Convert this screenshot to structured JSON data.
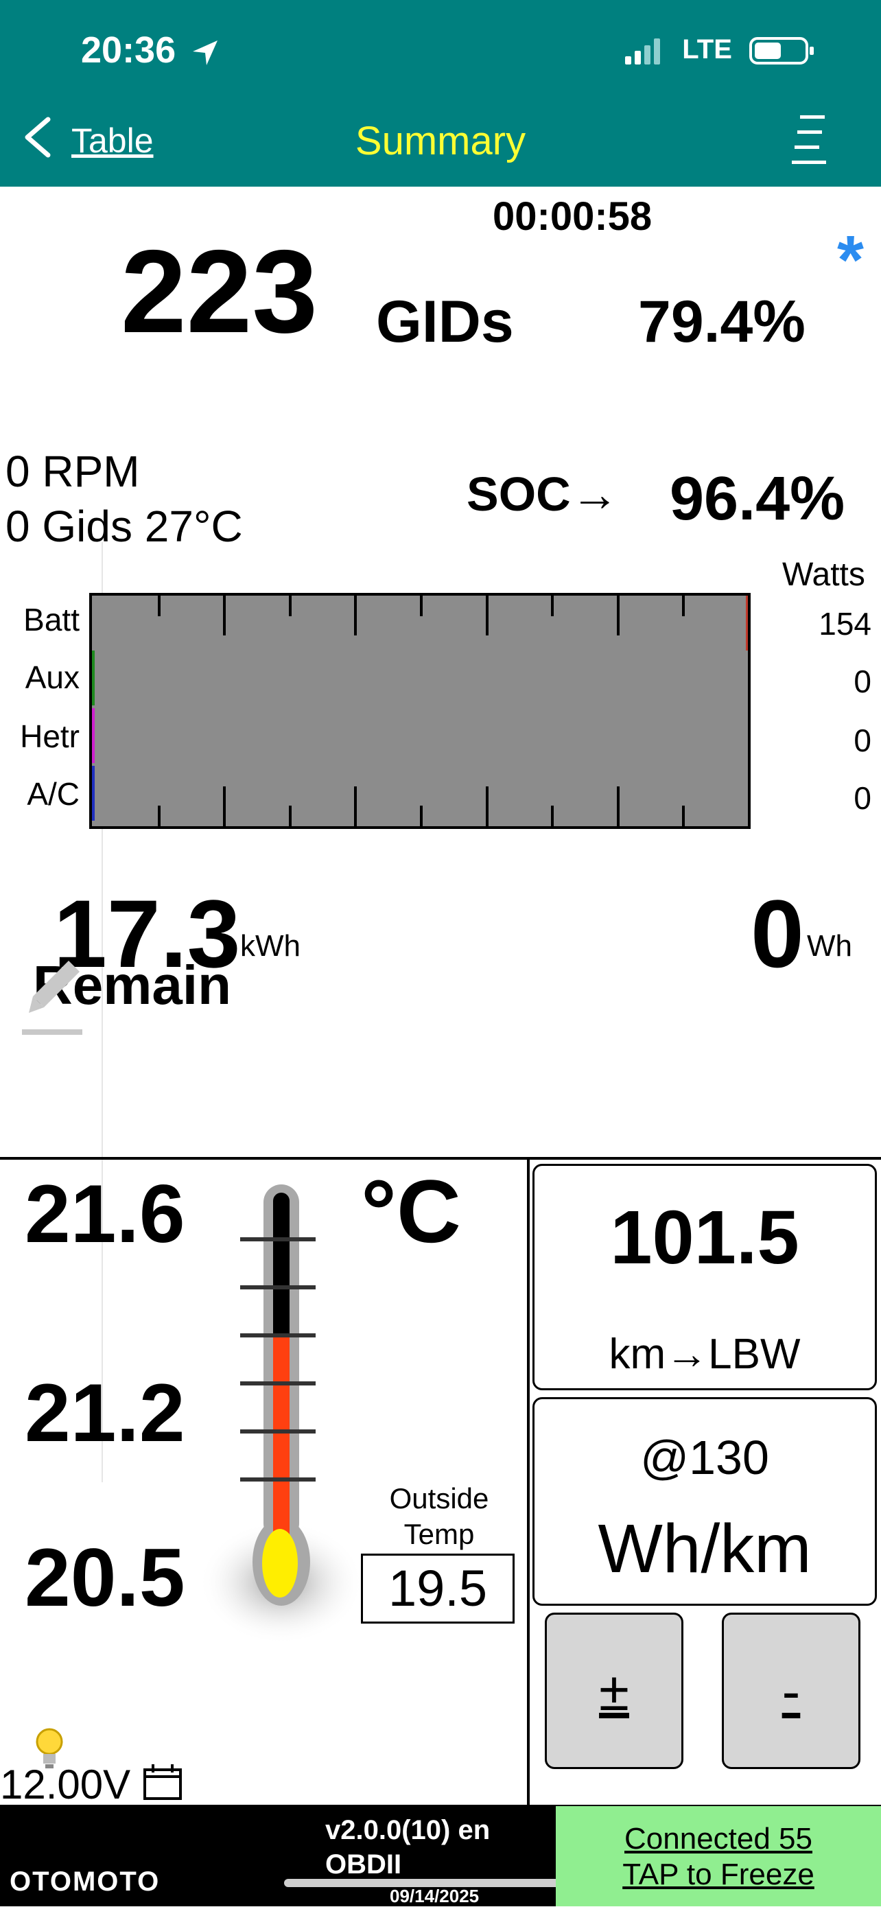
{
  "status": {
    "time": "20:36",
    "network": "LTE"
  },
  "nav": {
    "back_label": "Table",
    "title": "Summary"
  },
  "summary": {
    "timer": "00:00:58",
    "gids": "223",
    "gids_unit": "GIDs",
    "gids_percent": "79.4%",
    "star": "*",
    "rpm": "0 RPM",
    "gids_temp": "0 Gids 27°C",
    "soc_label": "SOC→",
    "soc_value": "96.4%"
  },
  "power": {
    "header": "Watts",
    "rows": [
      {
        "label": "Batt",
        "watts": "154",
        "color": "#c0392b"
      },
      {
        "label": "Aux",
        "watts": "0",
        "color": "#1e8c1e"
      },
      {
        "label": "Hetr",
        "watts": "0",
        "color": "#d020d0"
      },
      {
        "label": "A/C",
        "watts": "0",
        "color": "#2030c0"
      }
    ]
  },
  "energy": {
    "remain_value": "17.3",
    "remain_unit": "kWh",
    "remain_label": "Remain",
    "used_value": "0",
    "used_unit": "Wh"
  },
  "temps": {
    "t1": "21.6",
    "t2": "21.2",
    "t3": "20.5",
    "unit": "°C",
    "outside_label_1": "Outside",
    "outside_label_2": "Temp",
    "outside_value": "19.5",
    "thermometer_fill_fraction": 0.55
  },
  "range": {
    "value": "101.5",
    "unit": "km→LBW",
    "speed_label": "@130",
    "efficiency_unit": "Wh/km"
  },
  "buttons": {
    "plus": "±",
    "minus": "-"
  },
  "battery_voltage": "12.00V",
  "footer": {
    "left_text": "OTOMOTO",
    "version": "v2.0.0(10) en",
    "protocol": "OBDII",
    "date": "09/14/2025",
    "connection_1": "Connected 55",
    "connection_2": "TAP to Freeze"
  },
  "colors": {
    "header_bg": "#00807f",
    "title_color": "#ffff33",
    "connected_bg": "#90ee90",
    "star_color": "#2b8cf0"
  }
}
